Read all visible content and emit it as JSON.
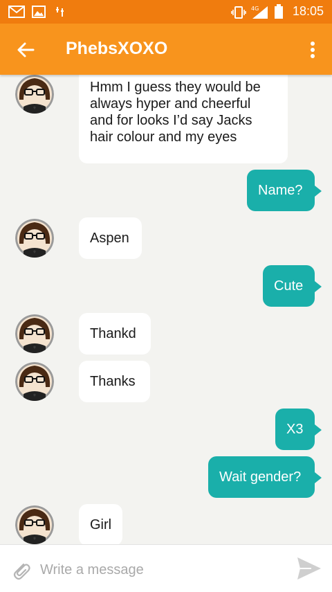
{
  "status_bar": {
    "time": "18:05",
    "network": "4G"
  },
  "header": {
    "title": "PhebsXOXO"
  },
  "messages": [
    {
      "side": "in",
      "text": "Hmm I guess they would be always hyper and cheerful and for looks I’d say Jacks hair colour and my eyes"
    },
    {
      "side": "out",
      "text": "Name?"
    },
    {
      "side": "in",
      "text": "Aspen"
    },
    {
      "side": "out",
      "text": "Cute"
    },
    {
      "side": "in",
      "text": "Thankd"
    },
    {
      "side": "in",
      "text": "Thanks"
    },
    {
      "side": "out",
      "text": "X3"
    },
    {
      "side": "out",
      "text": "Wait gender?"
    },
    {
      "side": "in",
      "text": "Girl"
    }
  ],
  "composer": {
    "placeholder": "Write a message",
    "value": ""
  },
  "colors": {
    "status": "#f07c0e",
    "appbar": "#f8941d",
    "outgoing": "#1aafaa",
    "incoming": "#ffffff",
    "background": "#f3f3f0"
  },
  "icons": {
    "back": "arrow-left-icon",
    "menu": "more-vert-icon",
    "attach": "paperclip-icon",
    "send": "send-icon",
    "status": [
      "gmail-icon",
      "gallery-icon",
      "signal-tower-icon",
      "vibrate-icon",
      "4g-signal-icon",
      "battery-icon"
    ]
  }
}
